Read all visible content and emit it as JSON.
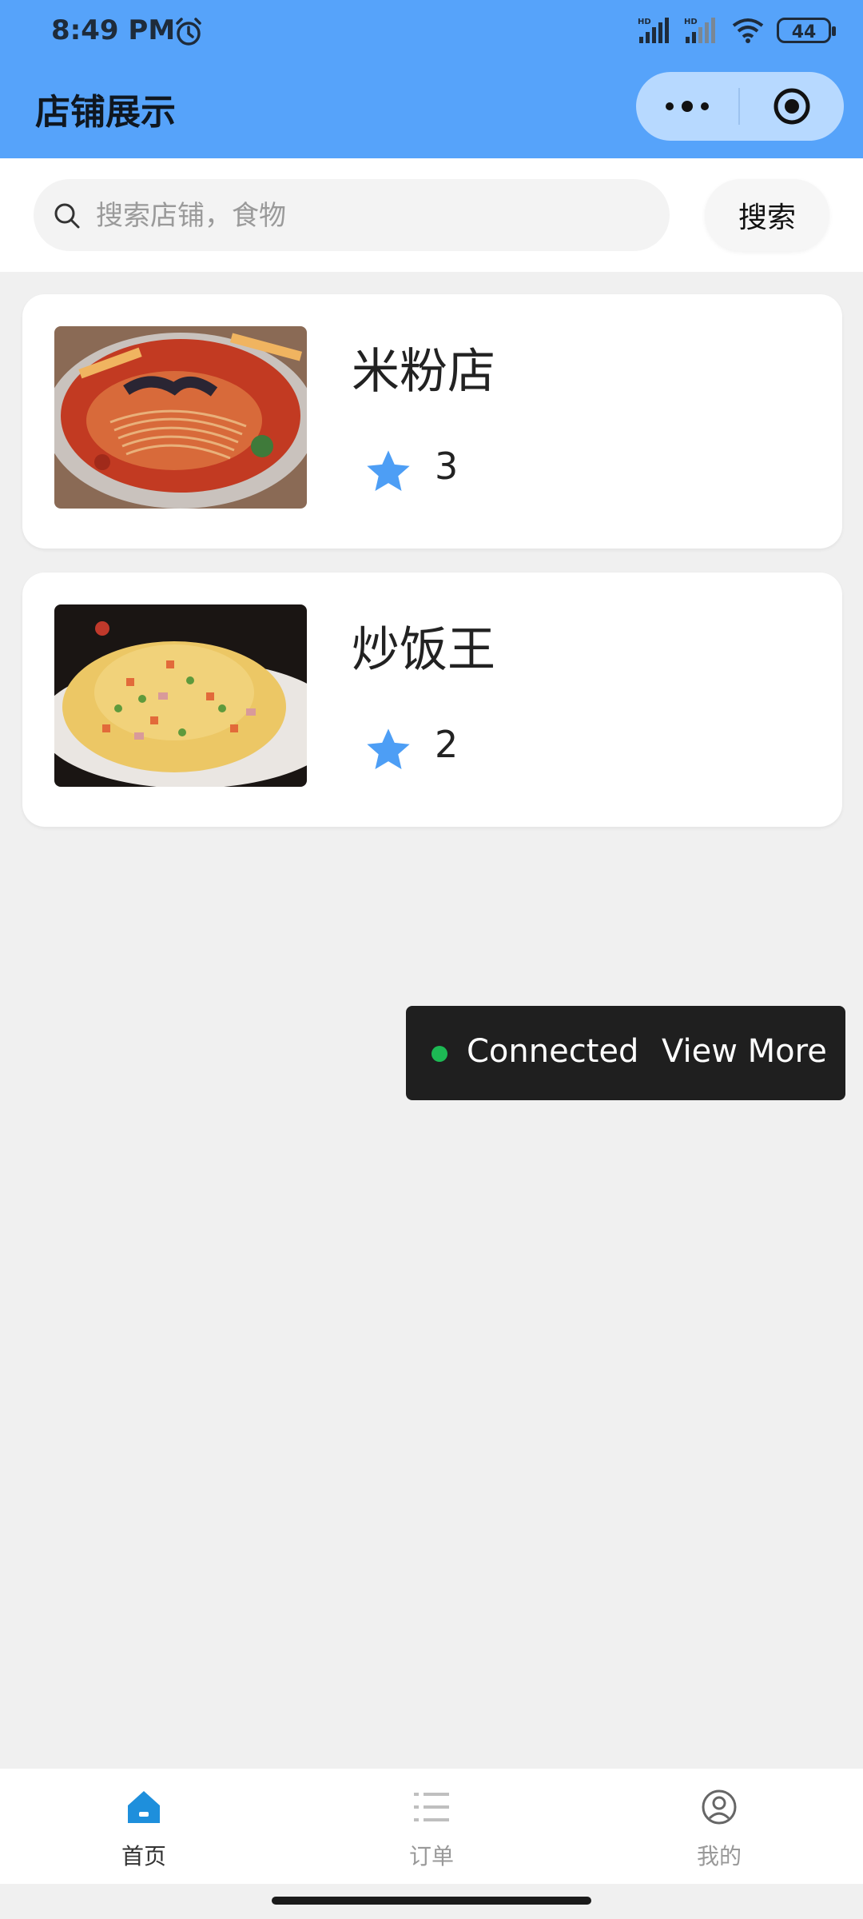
{
  "status": {
    "time": "8:49 PM",
    "battery": "44"
  },
  "header": {
    "title": "店铺展示"
  },
  "search": {
    "placeholder": "搜索店铺，食物",
    "button_label": "搜索"
  },
  "shops": [
    {
      "name": "米粉店",
      "rating": "3"
    },
    {
      "name": "炒饭王",
      "rating": "2"
    }
  ],
  "toast": {
    "status": "Connected",
    "action": "View More"
  },
  "tabs": [
    {
      "label": "首页",
      "icon": "home-icon",
      "active": true
    },
    {
      "label": "订单",
      "icon": "list-icon",
      "active": false
    },
    {
      "label": "我的",
      "icon": "user-icon",
      "active": false
    }
  ],
  "colors": {
    "accent": "#56a3fa",
    "tab_active": "#1e8fdc",
    "star": "#4d9ef5",
    "toast_dot": "#1db954"
  }
}
